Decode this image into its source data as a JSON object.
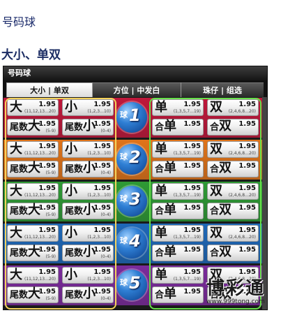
{
  "page_title": "号码球",
  "section_title": "大小、单双",
  "panel": {
    "title": "号码球",
    "tabs": [
      {
        "label": "大小 | 单双",
        "active": true
      },
      {
        "label": "方位 | 中发白",
        "active": false
      },
      {
        "label": "珠仔 | 组选",
        "active": false
      }
    ]
  },
  "balls": [
    {
      "qiu": "球",
      "num": "1",
      "bg": "#c0183b"
    },
    {
      "qiu": "球",
      "num": "2",
      "bg": "#e0741a"
    },
    {
      "qiu": "球",
      "num": "3",
      "bg": "#2e9a35"
    },
    {
      "qiu": "球",
      "num": "4",
      "bg": "#1e68b8"
    },
    {
      "qiu": "球",
      "num": "5",
      "bg": "#7b2b9c"
    }
  ],
  "bets": {
    "da": {
      "label": "大",
      "odds": "1.95",
      "sub": "(11,12,13…20)"
    },
    "xiao": {
      "label": "小",
      "odds": "1.95",
      "sub": "(1,2,3…10)"
    },
    "wei_da": {
      "prefix": "尾数",
      "label": "大",
      "odds": "1.95",
      "sub": "(5-9)"
    },
    "wei_xiao": {
      "prefix": "尾数",
      "label": "小",
      "odds": "1.95",
      "sub": "(0-4)"
    },
    "dan": {
      "label": "单",
      "odds": "1.95",
      "sub": "(1,3,5,7…19)"
    },
    "shuang": {
      "label": "双",
      "odds": "1.95",
      "sub": "(2,4,6,8…20)"
    },
    "he_dan": {
      "prefix": "合",
      "label": "单",
      "odds": "1.95"
    },
    "he_shuang": {
      "prefix": "合",
      "label": "双",
      "odds": "1.95"
    }
  },
  "watermark": {
    "text": "博彩通",
    "url": "www.999tong.com"
  }
}
